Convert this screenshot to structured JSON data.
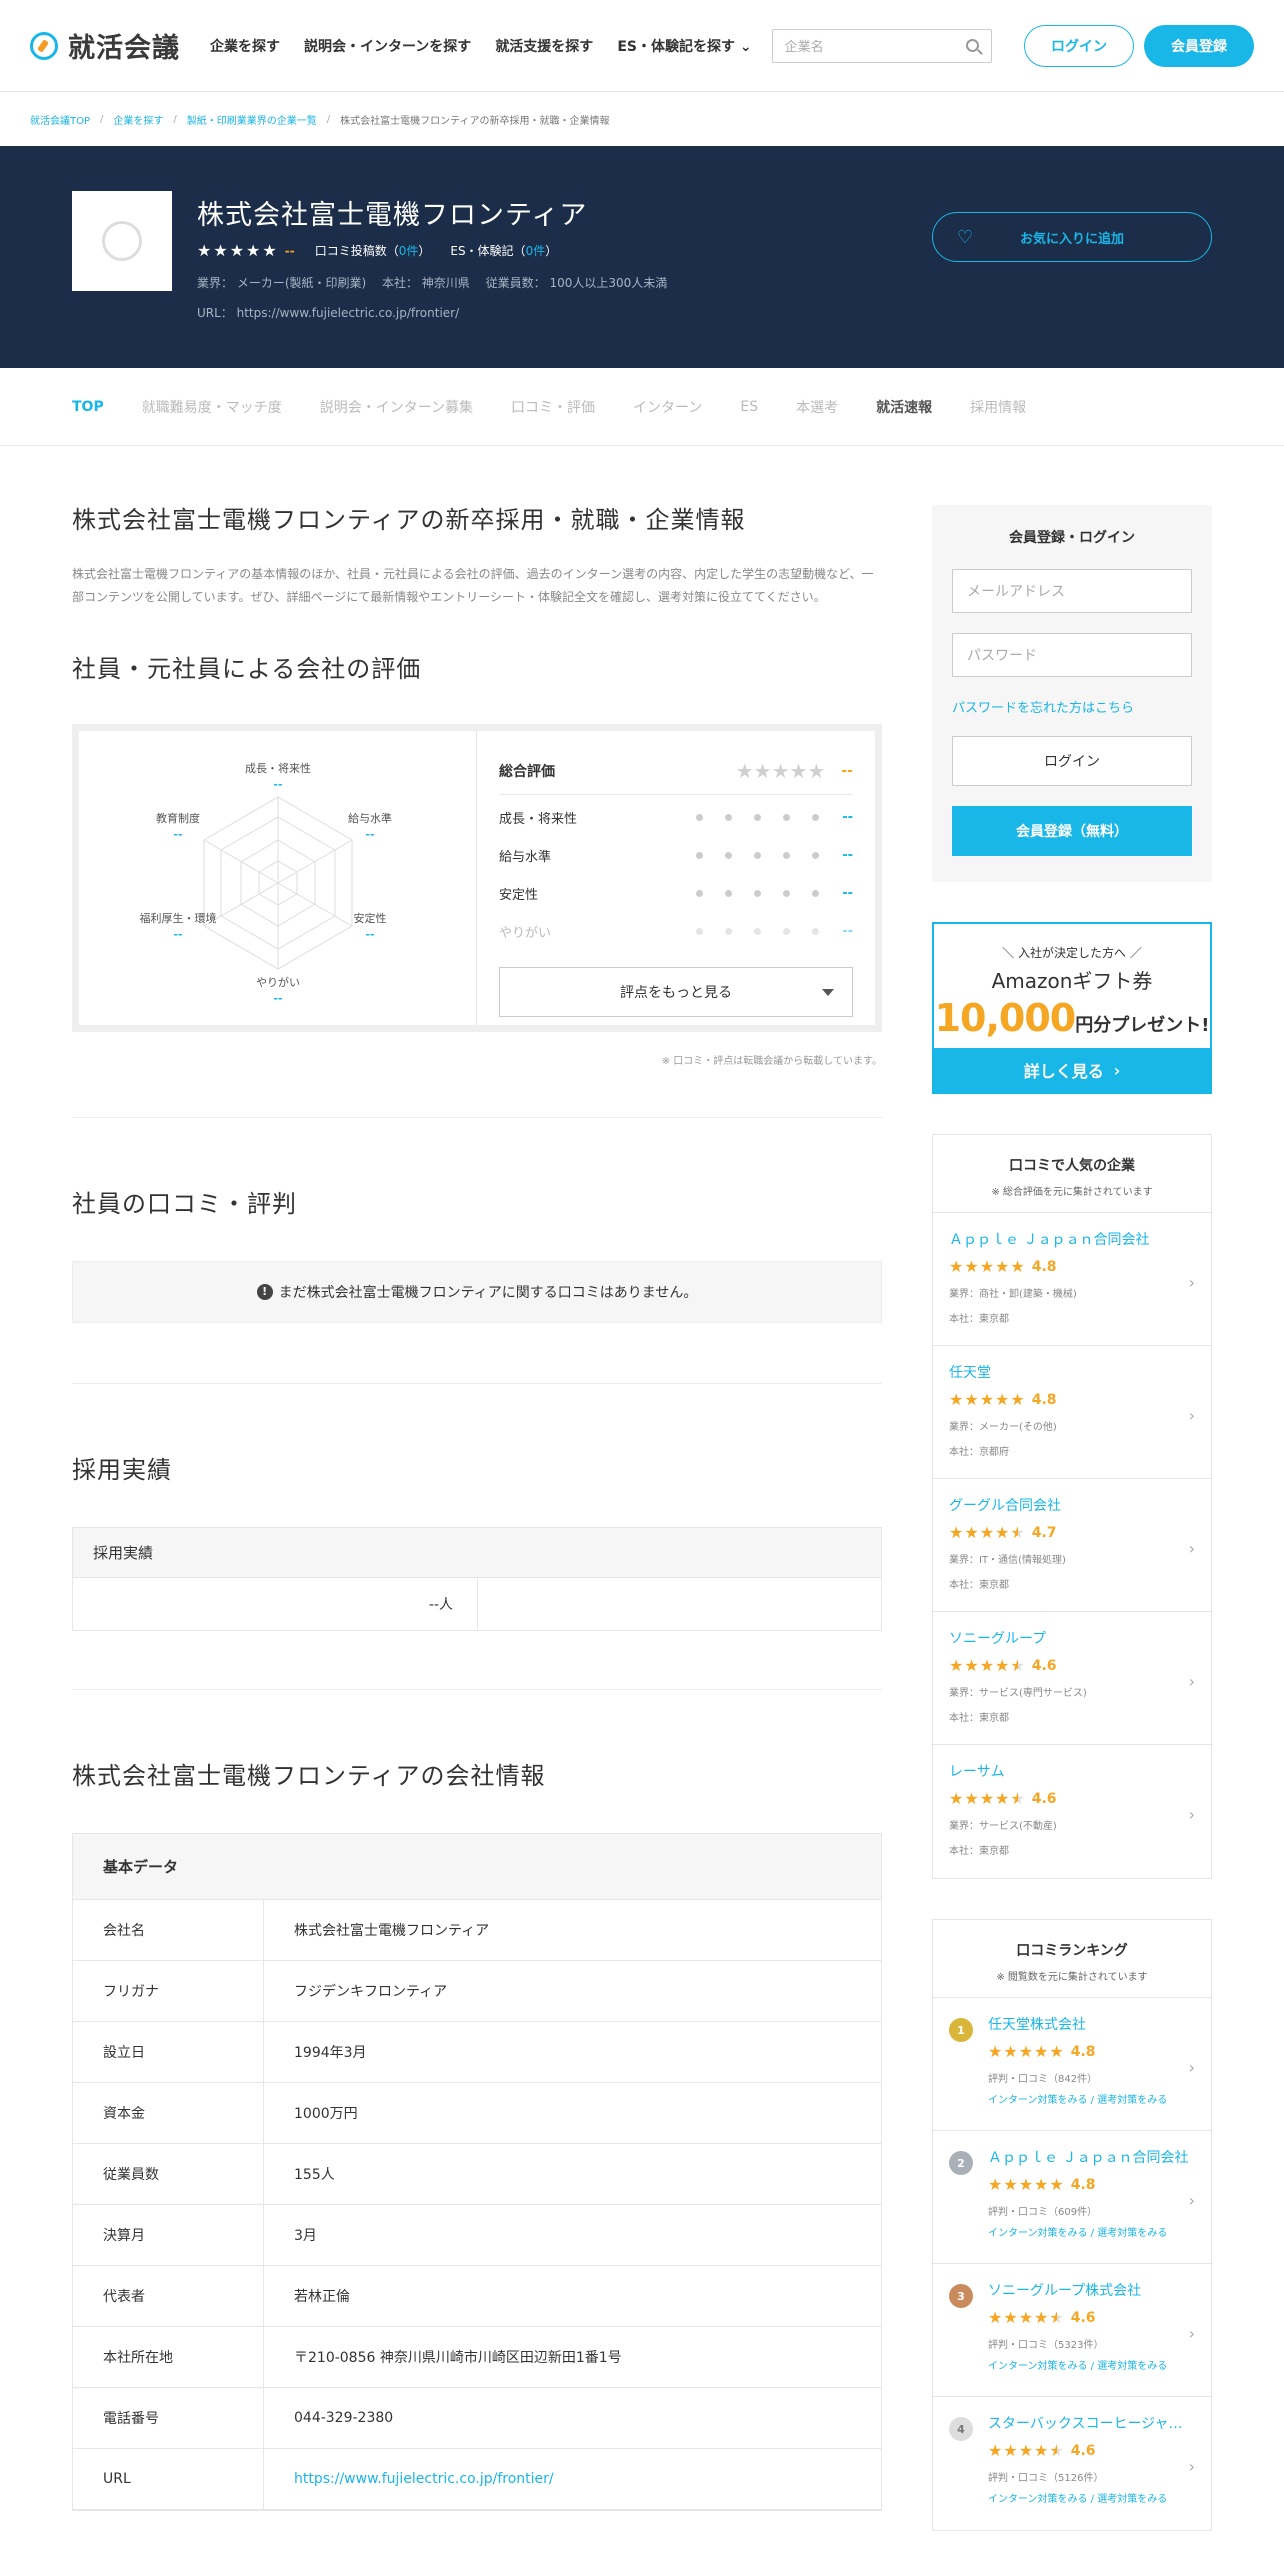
{
  "header": {
    "logo_text": "就活会議",
    "nav": [
      "企業を探す",
      "説明会・インターンを探す",
      "就活支援を探す",
      "ES・体験記を探す"
    ],
    "search_placeholder": "企業名",
    "login": "ログイン",
    "register": "会員登録"
  },
  "breadcrumb": [
    "就活会議TOP",
    "企業を探す",
    "製紙・印刷業業界の企業一覧",
    "株式会社富士電機フロンティアの新卒採用・就職・企業情報"
  ],
  "hero": {
    "company": "株式会社富士電機フロンティア",
    "rating_value": "--",
    "review_label": "口コミ投稿数（",
    "review_count": "0件",
    "review_close": "）",
    "es_label": "ES・体験記（",
    "es_count": "0件",
    "es_close": "）",
    "industry": "業界： メーカー(製紙・印刷業)　 本社： 神奈川県　 従業員数： 100人以上300人未満",
    "url_line": "URL： https://www.fujielectric.co.jp/frontier/",
    "fav_button": "お気に入りに追加"
  },
  "tabs": [
    "TOP",
    "就職難易度・マッチ度",
    "説明会・インターン募集",
    "口コミ・評価",
    "インターン",
    "ES",
    "本選考",
    "就活速報",
    "採用情報"
  ],
  "main": {
    "page_title": "株式会社富士電機フロンティアの新卒採用・就職・企業情報",
    "description": "株式会社富士電機フロンティアの基本情報のほか、社員・元社員による会社の評価、過去のインターン選考の内容、内定した学生の志望動機など、一部コンテンツを公開しています。ぜひ、詳細ページにて最新情報やエントリーシート・体験記全文を確認し、選考対策に役立ててください。",
    "rating_title": "社員・元社員による会社の評価",
    "radar_labels": [
      "成長・将来性",
      "給与水準",
      "安定性",
      "やりがい",
      "福利厚生・環境",
      "教育制度"
    ],
    "radar_value": "--",
    "overall_label": "総合評価",
    "overall_value": "--",
    "rating_rows": [
      {
        "label": "成長・将来性",
        "value": "--"
      },
      {
        "label": "給与水準",
        "value": "--"
      },
      {
        "label": "安定性",
        "value": "--"
      },
      {
        "label": "やりがい",
        "value": "--"
      }
    ],
    "more_button": "評点をもっと見る",
    "note": "※ 口コミ・評点は転職会議から転載しています。",
    "reviews_title": "社員の口コミ・評判",
    "no_reviews": "まだ株式会社富士電機フロンティアに関する口コミはありません。",
    "hiring_title": "採用実績",
    "hiring_header": "採用実績",
    "hiring_value": "--人",
    "info_title": "株式会社富士電機フロンティアの会社情報",
    "info_header": "基本データ",
    "info_rows": [
      {
        "k": "会社名",
        "v": "株式会社富士電機フロンティア"
      },
      {
        "k": "フリガナ",
        "v": "フジデンキフロンティア"
      },
      {
        "k": "設立日",
        "v": "1994年3月"
      },
      {
        "k": "資本金",
        "v": "1000万円"
      },
      {
        "k": "従業員数",
        "v": "155人"
      },
      {
        "k": "決算月",
        "v": "3月"
      },
      {
        "k": "代表者",
        "v": "若林正倫"
      },
      {
        "k": "本社所在地",
        "v": "〒210-0856 神奈川県川崎市川崎区田辺新田1番1号"
      },
      {
        "k": "電話番号",
        "v": "044-329-2380"
      },
      {
        "k": "URL",
        "v": "https://www.fujielectric.co.jp/frontier/"
      }
    ]
  },
  "sidebar": {
    "login_title": "会員登録・ログイン",
    "email_placeholder": "メールアドレス",
    "password_placeholder": "パスワード",
    "forgot": "パスワードを忘れた方はこちら",
    "login_button": "ログイン",
    "register_button": "会員登録（無料）",
    "promo": {
      "line1": "入社が決定した方へ",
      "line2": "Amazonギフト券",
      "amount": "10,000",
      "suffix": "円分プレゼント!",
      "cta": "詳しく見る"
    },
    "popular_title": "口コミで人気の企業",
    "popular_sub": "※ 総合評価を元に集計されています",
    "popular": [
      {
        "name": "Ａｐｐｌｅ Ｊａｐａｎ合同会社",
        "score": "4.8",
        "stars": 5,
        "industry": "業界：商社・卸(建築・機械)",
        "hq": "本社：東京都"
      },
      {
        "name": "任天堂",
        "score": "4.8",
        "stars": 5,
        "industry": "業界：メーカー(その他)",
        "hq": "本社：京都府"
      },
      {
        "name": "グーグル合同会社",
        "score": "4.7",
        "stars": 4.5,
        "industry": "業界：IT・通信(情報処理)",
        "hq": "本社：東京都"
      },
      {
        "name": "ソニーグループ",
        "score": "4.6",
        "stars": 4.5,
        "industry": "業界：サービス(専門サービス)",
        "hq": "本社：東京都"
      },
      {
        "name": "レーサム",
        "score": "4.6",
        "stars": 4.5,
        "industry": "業界：サービス(不動産)",
        "hq": "本社：東京都"
      }
    ],
    "ranking_title": "口コミランキング",
    "ranking_sub": "※ 閲覧数を元に集計されています",
    "ranking": [
      {
        "rank": "1",
        "color": "#d9b53a",
        "name": "任天堂株式会社",
        "score": "4.8",
        "stars": 5,
        "reviews": "評判・口コミ（842件）",
        "links": "インターン対策をみる / 選考対策をみる"
      },
      {
        "rank": "2",
        "color": "#a9b0b7",
        "name": "Ａｐｐｌｅ Ｊａｐａｎ合同会社",
        "score": "4.8",
        "stars": 5,
        "reviews": "評判・口コミ（609件）",
        "links": "インターン対策をみる / 選考対策をみる"
      },
      {
        "rank": "3",
        "color": "#c98b5c",
        "name": "ソニーグループ株式会社",
        "score": "4.6",
        "stars": 4.5,
        "reviews": "評判・口コミ（5323件）",
        "links": "インターン対策をみる / 選考対策をみる"
      },
      {
        "rank": "4",
        "color": "#dddddd",
        "name": "スターバックスコーヒージャパン株式会社",
        "score": "4.6",
        "stars": 4.5,
        "reviews": "評判・口コミ（5126件）",
        "links": "インターン対策をみる / 選考対策をみる"
      }
    ]
  }
}
